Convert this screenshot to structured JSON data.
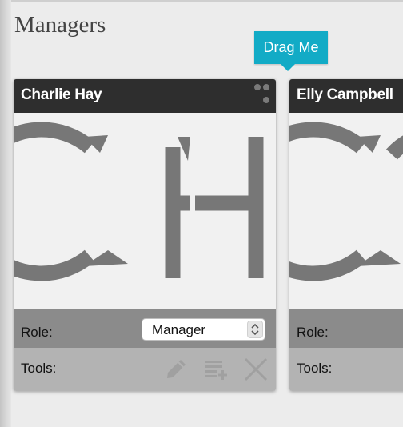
{
  "page": {
    "title": "Managers"
  },
  "tooltip": {
    "text": "Drag Me"
  },
  "colors": {
    "accent": "#12abc6",
    "header": "#2e2e2e",
    "role_bar": "#8b8b8b",
    "tools_bar": "#b3b3b3",
    "logo": "#777777"
  },
  "cards": [
    {
      "name": "Charlie Hay",
      "logo_letters": "CH",
      "role_label": "Role:",
      "role_value": "Manager",
      "tools_label": "Tools:",
      "icons": [
        "drag-handle-icon",
        "pencil-icon",
        "add-list-icon",
        "close-icon"
      ]
    },
    {
      "name": "Elly Campbell",
      "logo_letters": "EC",
      "role_label": "Role:",
      "tools_label": "Tools:"
    }
  ]
}
